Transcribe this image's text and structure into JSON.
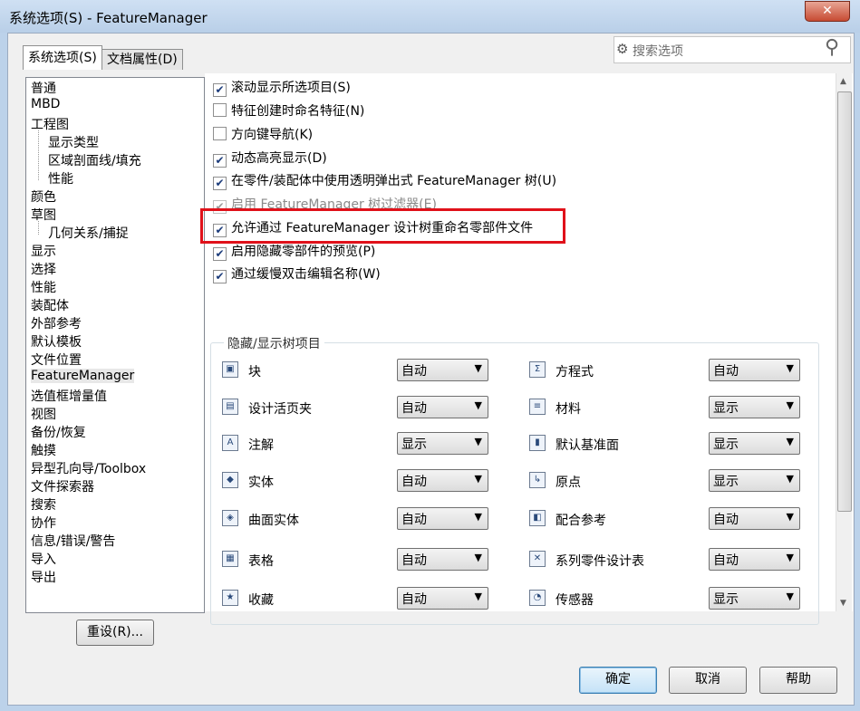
{
  "window": {
    "title": "系统选项(S) - FeatureManager",
    "close": "✕"
  },
  "tabs": [
    "系统选项(S)",
    "文档属性(D)"
  ],
  "search": {
    "placeholder": "搜索选项"
  },
  "left_items": [
    "普通",
    "MBD",
    "工程图",
    "显示类型",
    "区域剖面线/填充",
    "性能",
    "颜色",
    "草图",
    "几何关系/捕捉",
    "显示",
    "选择",
    "性能",
    "装配体",
    "外部参考",
    "默认模板",
    "文件位置",
    "FeatureManager",
    "选值框增量值",
    "视图",
    "备份/恢复",
    "触摸",
    "异型孔向导/Toolbox",
    "文件探索器",
    "搜索",
    "协作",
    "信息/错误/警告",
    "导入",
    "导出"
  ],
  "selected_left_item": "FeatureManager",
  "reset_label": "重设(R)...",
  "checkboxes": [
    {
      "label": "滚动显示所选项目(S)",
      "checked": true,
      "enabled": true
    },
    {
      "label": "特征创建时命名特征(N)",
      "checked": false,
      "enabled": true
    },
    {
      "label": "方向键导航(K)",
      "checked": false,
      "enabled": true
    },
    {
      "label": "动态高亮显示(D)",
      "checked": true,
      "enabled": true
    },
    {
      "label": "在零件/装配体中使用透明弹出式 FeatureManager 树(U)",
      "checked": true,
      "enabled": true
    },
    {
      "label": "启用 FeatureManager 树过滤器(E)",
      "checked": true,
      "enabled": false
    },
    {
      "label": "允许通过 FeatureManager 设计树重命名零部件文件",
      "checked": true,
      "enabled": true
    },
    {
      "label": "启用隐藏零部件的预览(P)",
      "checked": true,
      "enabled": true
    },
    {
      "label": "通过缓慢双击编辑名称(W)",
      "checked": true,
      "enabled": true
    }
  ],
  "tree_group_title": "隐藏/显示树项目",
  "tree_items_left": [
    {
      "label": "块",
      "value": "自动",
      "icon": "block-icon"
    },
    {
      "label": "设计活页夹",
      "value": "自动",
      "icon": "binder-icon"
    },
    {
      "label": "注解",
      "value": "显示",
      "icon": "annotation-icon"
    },
    {
      "label": "实体",
      "value": "自动",
      "icon": "solid-body-icon"
    },
    {
      "label": "曲面实体",
      "value": "自动",
      "icon": "surface-body-icon"
    },
    {
      "label": "表格",
      "value": "自动",
      "icon": "table-icon"
    },
    {
      "label": "收藏",
      "value": "自动",
      "icon": "favorites-icon"
    }
  ],
  "tree_items_right": [
    {
      "label": "方程式",
      "value": "自动",
      "icon": "equation-icon"
    },
    {
      "label": "材料",
      "value": "显示",
      "icon": "material-icon"
    },
    {
      "label": "默认基准面",
      "value": "显示",
      "icon": "plane-icon"
    },
    {
      "label": "原点",
      "value": "显示",
      "icon": "origin-icon"
    },
    {
      "label": "配合参考",
      "value": "自动",
      "icon": "mate-reference-icon"
    },
    {
      "label": "系列零件设计表",
      "value": "自动",
      "icon": "design-table-icon"
    },
    {
      "label": "传感器",
      "value": "显示",
      "icon": "sensor-icon"
    }
  ],
  "buttons": {
    "ok": "确定",
    "cancel": "取消",
    "help": "帮助"
  }
}
